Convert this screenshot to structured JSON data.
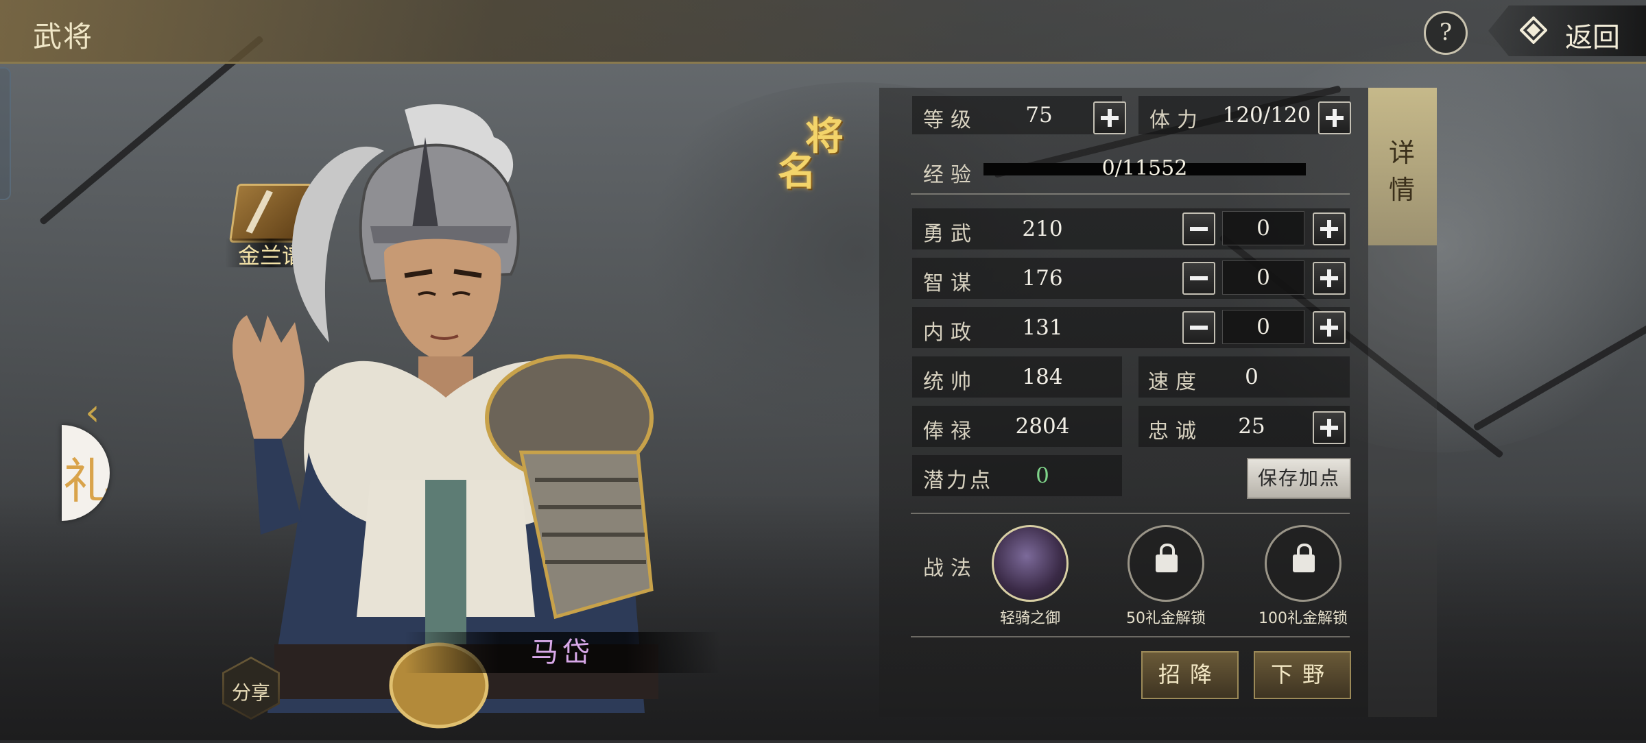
{
  "header": {
    "title": "武将",
    "help_label": "?",
    "back_label": "返回"
  },
  "left": {
    "gift_char": "礼",
    "jinlanpu_label": "金兰谱",
    "prev_arrow": "‹"
  },
  "hero": {
    "name": "马岱",
    "badge_chars": [
      "将",
      "名"
    ],
    "share_label": "分享"
  },
  "detail_tab": {
    "chars": [
      "详",
      "情"
    ]
  },
  "stats": {
    "level": {
      "label": "等级",
      "value": "75"
    },
    "stamina": {
      "label": "体力",
      "value": "120/120"
    },
    "exp": {
      "label": "经验",
      "value": "0/11552",
      "progress": 0
    },
    "attributes": [
      {
        "label": "勇武",
        "value": "210",
        "alloc": "0"
      },
      {
        "label": "智谋",
        "value": "176",
        "alloc": "0"
      },
      {
        "label": "内政",
        "value": "131",
        "alloc": "0"
      }
    ],
    "command": {
      "label": "统帅",
      "value": "184"
    },
    "speed": {
      "label": "速度",
      "value": "0"
    },
    "salary": {
      "label": "俸禄",
      "value": "2804"
    },
    "loyalty": {
      "label": "忠诚",
      "value": "25"
    },
    "potential": {
      "label": "潜力点",
      "value": "0"
    },
    "save_label": "保存加点"
  },
  "skills": {
    "label": "战法",
    "items": [
      {
        "name": "轻骑之御",
        "locked": false
      },
      {
        "name": "50礼金解锁",
        "locked": true
      },
      {
        "name": "100礼金解锁",
        "locked": true
      }
    ]
  },
  "actions": {
    "recruit_label": "招降",
    "dismiss_label": "下野"
  },
  "colors": {
    "gold": "#f3d46a",
    "potential_green": "#7fd48a",
    "name_purple": "#d8a8e8"
  }
}
